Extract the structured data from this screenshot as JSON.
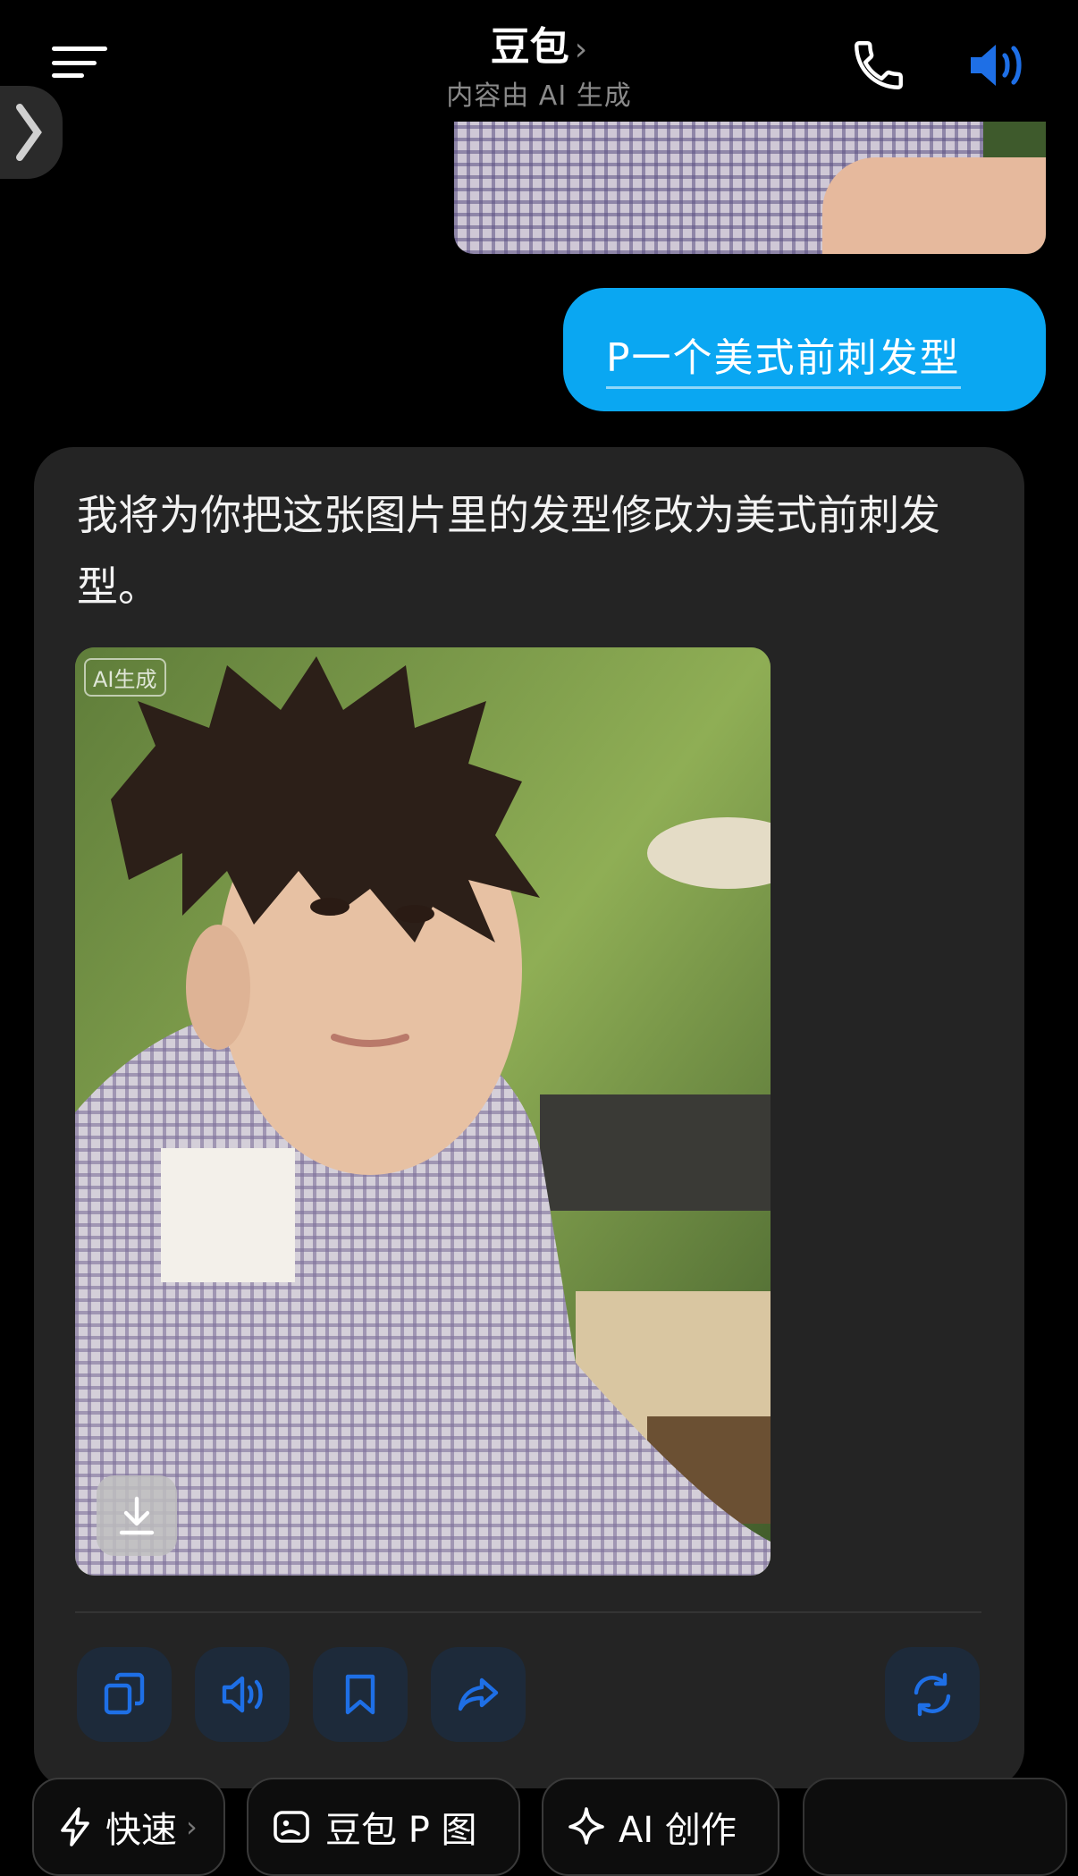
{
  "header": {
    "title": "豆包",
    "title_chevron": "›",
    "subtitle": "内容由 AI 生成"
  },
  "side_tab_glyph": "❯",
  "messages": {
    "user": {
      "text": "P一个美式前刺发型"
    },
    "ai": {
      "text": "我将为你把这张图片里的发型修改为美式前刺发型。",
      "image_badge": "AI生成"
    }
  },
  "actions": [
    "copy-icon",
    "speaker-icon",
    "bookmark-icon",
    "share-icon",
    "regenerate-icon"
  ],
  "chips": [
    {
      "label": "快速",
      "chevron": "›",
      "icon": "lightning-icon"
    },
    {
      "label": "豆包 P 图",
      "icon": "image-edit-icon"
    },
    {
      "label": "AI 创作",
      "icon": "sparkle-icon"
    }
  ],
  "colors": {
    "accent": "#0aa7f2",
    "icon_blue": "#1e6fe6",
    "card_bg": "#242424"
  }
}
